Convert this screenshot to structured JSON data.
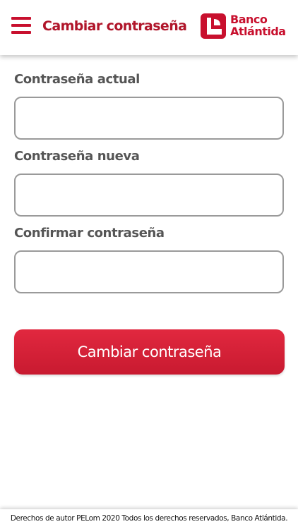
{
  "header": {
    "title": "Cambiar contraseña",
    "menu_icon": "hamburger-menu-icon",
    "brand": {
      "line1": "Banco",
      "line2": "Atlántida",
      "color": "#c8102e"
    }
  },
  "form": {
    "fields": [
      {
        "label": "Contraseña actual",
        "value": ""
      },
      {
        "label": "Contraseña nueva",
        "value": ""
      },
      {
        "label": "Confirmar contraseña",
        "value": ""
      }
    ],
    "submit_label": "Cambiar contraseña"
  },
  "footer": {
    "copyright": "Derechos de autor PELom 2020 Todos los derechos reservados, Banco Atlántida."
  },
  "colors": {
    "accent": "#c8102e",
    "label_gray": "#555555",
    "input_border": "#9a9a9a"
  }
}
